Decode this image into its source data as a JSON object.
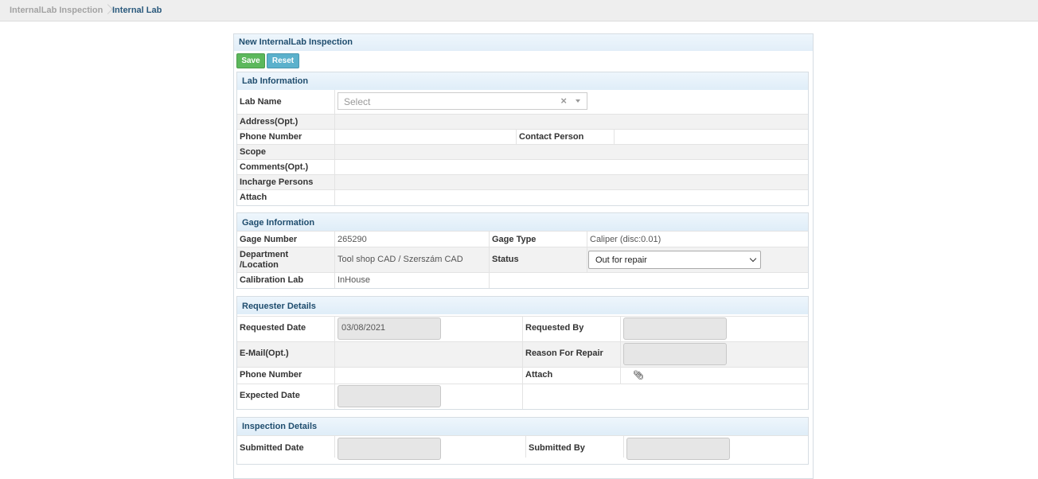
{
  "breadcrumb": {
    "parent": "InternalLab Inspection",
    "current": "Internal Lab"
  },
  "form": {
    "title": "New InternalLab Inspection",
    "save_label": "Save",
    "reset_label": "Reset"
  },
  "lab_info": {
    "title": "Lab Information",
    "lab_name_label": "Lab Name",
    "lab_name_placeholder": "Select",
    "address_label": "Address(Opt.)",
    "phone_label": "Phone Number",
    "contact_label": "Contact Person",
    "scope_label": "Scope",
    "comments_label": "Comments(Opt.)",
    "incharge_label": "Incharge Persons",
    "attach_label": "Attach"
  },
  "gage_info": {
    "title": "Gage Information",
    "gage_number_label": "Gage Number",
    "gage_number": "265290",
    "gage_type_label": "Gage Type",
    "gage_type": "Caliper (disc:0.01)",
    "department_label_1": "Department",
    "department_label_2": "/Location",
    "department": "Tool shop CAD / Szerszám CAD",
    "status_label": "Status",
    "status_value": "Out for repair",
    "calibration_lab_label": "Calibration Lab",
    "calibration_lab": "InHouse"
  },
  "requester": {
    "title": "Requester Details",
    "requested_date_label": "Requested Date",
    "requested_date": "03/08/2021",
    "requested_by_label": "Requested By",
    "email_label": "E-Mail(Opt.)",
    "reason_label": "Reason For Repair",
    "phone_label": "Phone Number",
    "attach_label": "Attach",
    "expected_date_label": "Expected Date"
  },
  "inspection": {
    "title": "Inspection Details",
    "submitted_date_label": "Submitted Date",
    "submitted_by_label": "Submitted By"
  },
  "icons": {
    "paperclip": "paperclip-icon",
    "clear": "clear-icon",
    "caret": "caret-down-icon"
  },
  "colors": {
    "save": "#5cb85c",
    "reset": "#5bb1cc",
    "heading": "#1f4d6e",
    "section_bg": "#e6f1fa"
  }
}
